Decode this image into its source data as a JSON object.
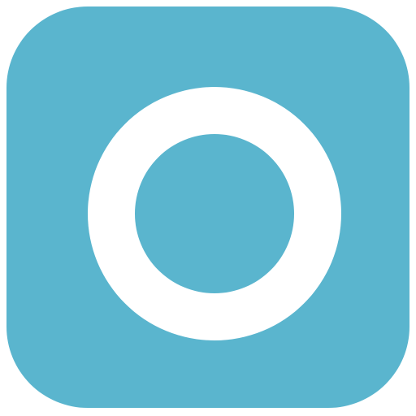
{
  "icon": {
    "name": "ring-icon",
    "tile_color": "#5ab5ce",
    "ring_color": "#ffffff",
    "background_color": "#ffffff"
  }
}
